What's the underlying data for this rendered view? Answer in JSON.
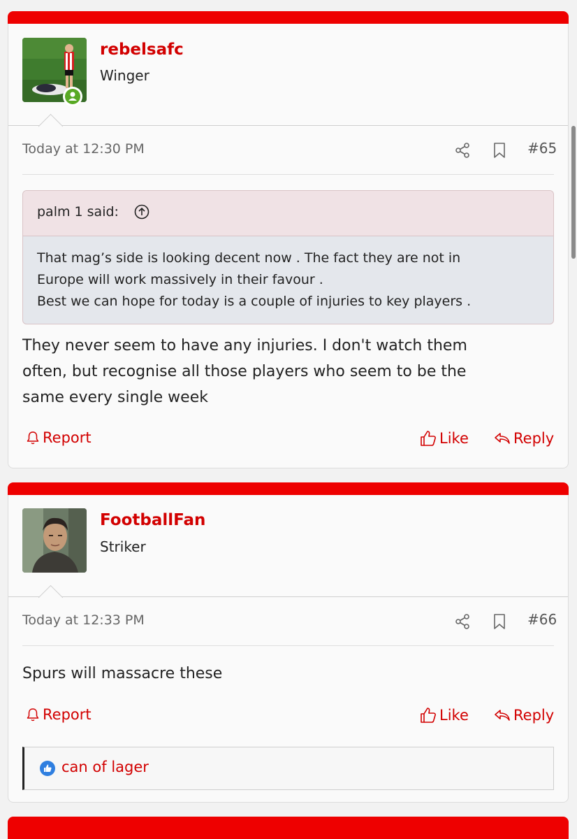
{
  "posts": [
    {
      "username": "rebelsafc",
      "user_title": "Winger",
      "date": "Today at 12:30 PM",
      "number": "#65",
      "quote": {
        "author": "palm 1 said:",
        "lines": [
          "That mag’s side is looking decent now . The fact they are not in",
          "Europe will work massively in their favour .",
          "Best we can hope for today is a couple of injuries to key players ."
        ]
      },
      "message_lines": [
        "They never seem to have any injuries. I don't watch them",
        "often, but recognise all those players who seem to be the",
        "same every single week"
      ],
      "actions": {
        "report": "Report",
        "like": "Like",
        "reply": "Reply"
      }
    },
    {
      "username": "FootballFan",
      "user_title": "Striker",
      "date": "Today at 12:33 PM",
      "number": "#66",
      "message_lines": [
        "Spurs will massacre these"
      ],
      "actions": {
        "report": "Report",
        "like": "Like",
        "reply": "Reply"
      },
      "reactions": {
        "users": "can of lager"
      }
    }
  ],
  "colors": {
    "accent": "#ee0000",
    "link": "#d20000",
    "online": "#58a924",
    "like_badge": "#2f7fe0"
  },
  "icons": {
    "share": "share-icon",
    "bookmark": "bookmark-icon",
    "report": "bell-icon",
    "like": "thumbs-up-icon",
    "reply": "reply-icon",
    "quote_jump": "arrow-up-circle-icon",
    "online": "user-online-icon"
  }
}
